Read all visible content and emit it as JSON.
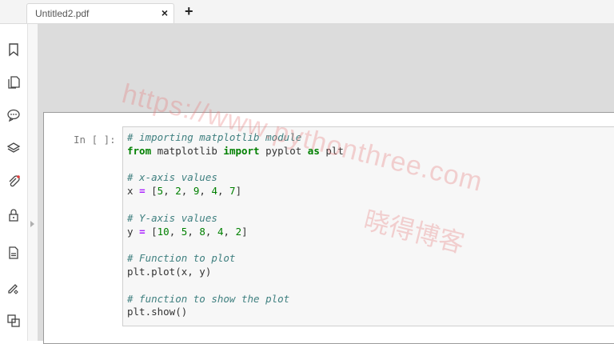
{
  "tabs": [
    {
      "title": "Untitled2.pdf",
      "close_icon": "close-icon"
    }
  ],
  "new_tab_label": "+",
  "sidebar": {
    "icons": [
      "bookmark-icon",
      "pages-icon",
      "comment-icon",
      "layers-icon",
      "attachment-icon",
      "lock-icon",
      "document-icon",
      "signature-icon",
      "compare-icon"
    ]
  },
  "cell": {
    "prompt": "In [ ]:",
    "lines": [
      [
        {
          "t": "cm",
          "v": "# importing matplotlib module"
        }
      ],
      [
        {
          "t": "kw",
          "v": "from"
        },
        {
          "t": "plain",
          "v": " matplotlib "
        },
        {
          "t": "kw",
          "v": "import"
        },
        {
          "t": "plain",
          "v": " pyplot "
        },
        {
          "t": "kw",
          "v": "as"
        },
        {
          "t": "plain",
          "v": " plt"
        }
      ],
      [],
      [
        {
          "t": "cm",
          "v": "# x-axis values"
        }
      ],
      [
        {
          "t": "plain",
          "v": "x "
        },
        {
          "t": "op",
          "v": "="
        },
        {
          "t": "plain",
          "v": " ["
        },
        {
          "t": "num",
          "v": "5"
        },
        {
          "t": "plain",
          "v": ", "
        },
        {
          "t": "num",
          "v": "2"
        },
        {
          "t": "plain",
          "v": ", "
        },
        {
          "t": "num",
          "v": "9"
        },
        {
          "t": "plain",
          "v": ", "
        },
        {
          "t": "num",
          "v": "4"
        },
        {
          "t": "plain",
          "v": ", "
        },
        {
          "t": "num",
          "v": "7"
        },
        {
          "t": "plain",
          "v": "]"
        }
      ],
      [],
      [
        {
          "t": "cm",
          "v": "# Y-axis values"
        }
      ],
      [
        {
          "t": "plain",
          "v": "y "
        },
        {
          "t": "op",
          "v": "="
        },
        {
          "t": "plain",
          "v": " ["
        },
        {
          "t": "num",
          "v": "10"
        },
        {
          "t": "plain",
          "v": ", "
        },
        {
          "t": "num",
          "v": "5"
        },
        {
          "t": "plain",
          "v": ", "
        },
        {
          "t": "num",
          "v": "8"
        },
        {
          "t": "plain",
          "v": ", "
        },
        {
          "t": "num",
          "v": "4"
        },
        {
          "t": "plain",
          "v": ", "
        },
        {
          "t": "num",
          "v": "2"
        },
        {
          "t": "plain",
          "v": "]"
        }
      ],
      [],
      [
        {
          "t": "cm",
          "v": "# Function to plot"
        }
      ],
      [
        {
          "t": "plain",
          "v": "plt.plot(x, y)"
        }
      ],
      [],
      [
        {
          "t": "cm",
          "v": "# function to show the plot"
        }
      ],
      [
        {
          "t": "plain",
          "v": "plt.show()"
        }
      ]
    ]
  },
  "watermark": {
    "url": "https://www.pythonthree.com",
    "cn": "晓得博客"
  }
}
